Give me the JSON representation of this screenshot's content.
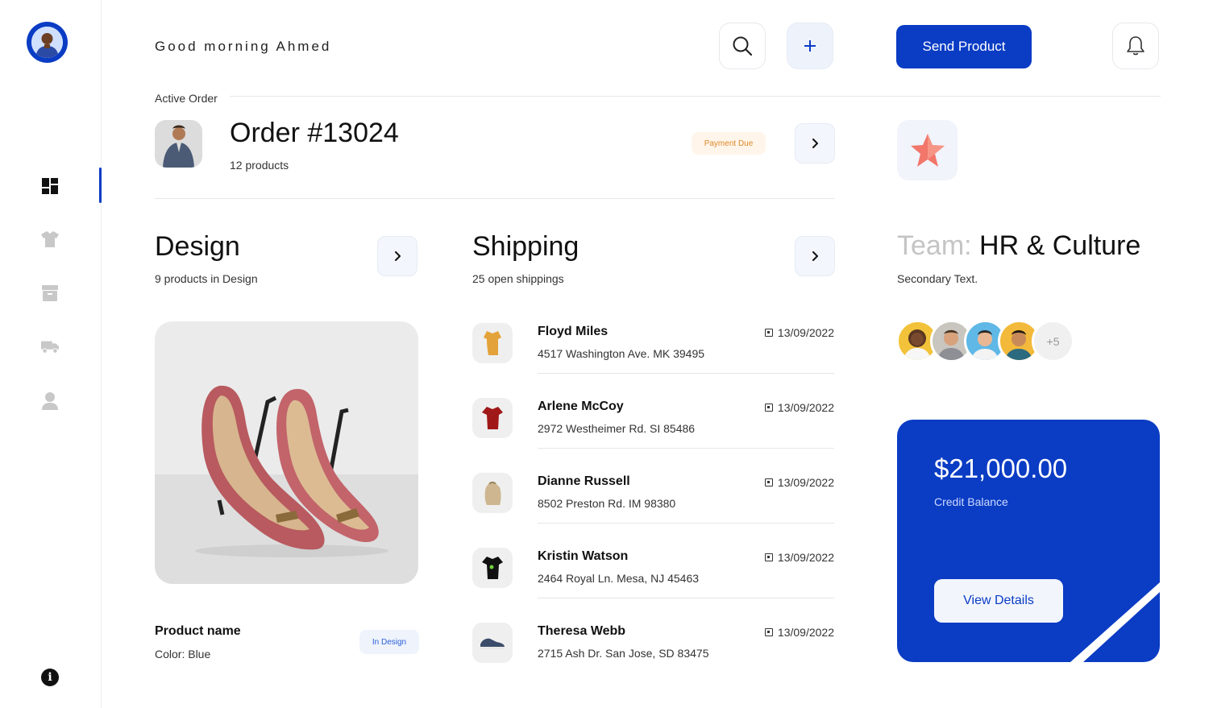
{
  "header": {
    "greeting": "Good morning Ahmed",
    "send_button": "Send Product",
    "search_icon": "search-icon",
    "add_icon": "plus-icon",
    "bell_icon": "bell-icon"
  },
  "sidebar": {
    "items": [
      {
        "icon": "dashboard-icon",
        "active": true
      },
      {
        "icon": "shirt-icon",
        "active": false
      },
      {
        "icon": "archive-icon",
        "active": false
      },
      {
        "icon": "truck-icon",
        "active": false
      },
      {
        "icon": "user-icon",
        "active": false
      }
    ],
    "info_icon": "i"
  },
  "active_order": {
    "label": "Active Order",
    "title": "Order #13024",
    "subtitle": "12 products",
    "badge": "Payment Due"
  },
  "design": {
    "title": "Design",
    "subtitle": "9 products in Design",
    "product_name": "Product name",
    "product_color": "Color: Blue",
    "badge": "In Design"
  },
  "shipping": {
    "title": "Shipping",
    "subtitle": "25 open shippings",
    "rows": [
      {
        "name": "Floyd Miles",
        "address": "4517 Washington Ave. MK 39495",
        "date": "13/09/2022",
        "item": "tshirt-yellow"
      },
      {
        "name": "Arlene McCoy",
        "address": "2972 Westheimer Rd. SI 85486",
        "date": "13/09/2022",
        "item": "tshirt-red"
      },
      {
        "name": "Dianne Russell",
        "address": "8502 Preston Rd. IM 98380",
        "date": "13/09/2022",
        "item": "backpack"
      },
      {
        "name": "Kristin Watson",
        "address": "2464 Royal Ln. Mesa, NJ 45463",
        "date": "13/09/2022",
        "item": "tshirt-black"
      },
      {
        "name": "Theresa Webb",
        "address": "2715 Ash Dr. San Jose, SD 83475",
        "date": "13/09/2022",
        "item": "sneaker"
      }
    ]
  },
  "team": {
    "prefix": "Team: ",
    "name": "HR & Culture",
    "subtitle": "Secondary Text.",
    "more_count": "+5"
  },
  "credit": {
    "amount": "$21,000.00",
    "label": "Credit Balance",
    "button": "View Details"
  },
  "colors": {
    "accent": "#0a3cc4",
    "payment_due": "#e0892a",
    "in_design": "#2c5fd8"
  }
}
